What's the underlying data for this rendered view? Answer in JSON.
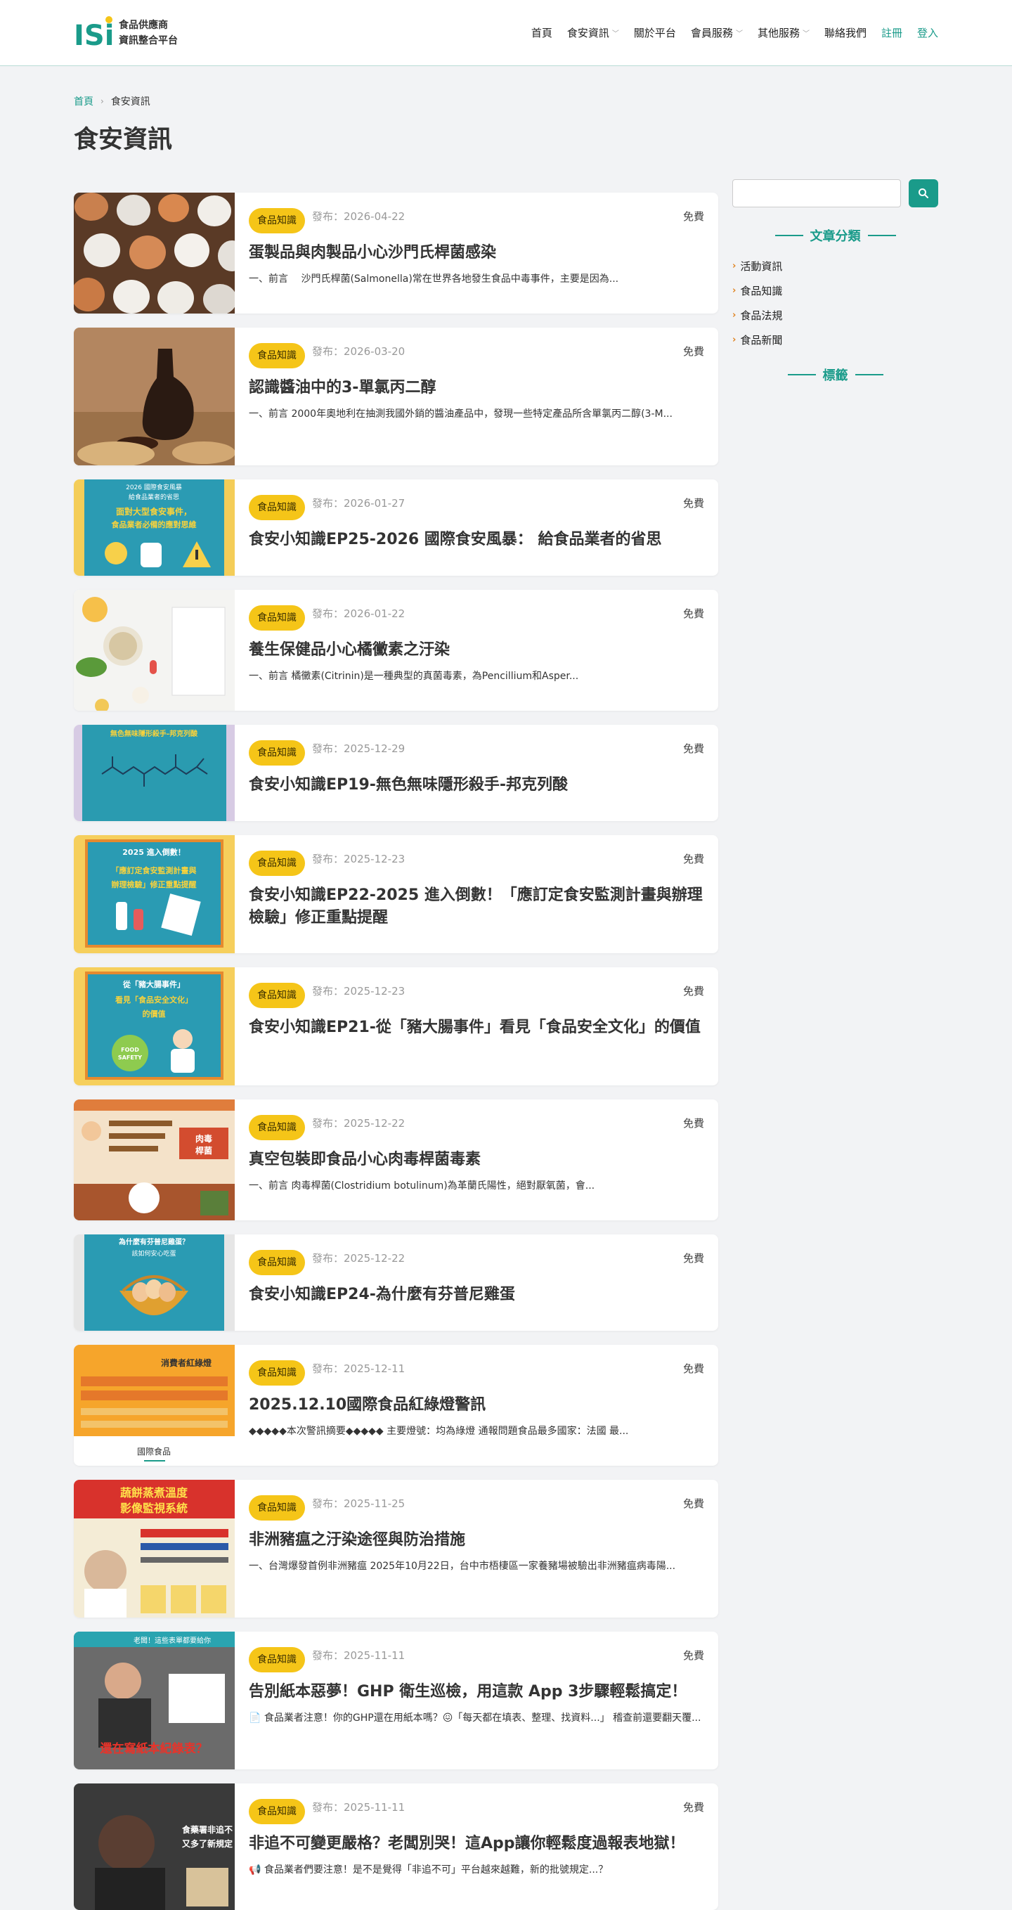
{
  "header": {
    "logo_text": "ISi",
    "brand_line1": "食品供應商",
    "brand_line2": "資訊整合平台",
    "nav": [
      {
        "label": "首頁",
        "dropdown": false
      },
      {
        "label": "食安資訊",
        "dropdown": true
      },
      {
        "label": "關於平台",
        "dropdown": false
      },
      {
        "label": "會員服務",
        "dropdown": true
      },
      {
        "label": "其他服務",
        "dropdown": true
      },
      {
        "label": "聯絡我們",
        "dropdown": false
      }
    ],
    "register_label": "註冊",
    "login_label": "登入"
  },
  "breadcrumb": {
    "home": "首頁",
    "current": "食安資訊"
  },
  "page_title": "食安資訊",
  "articles": [
    {
      "category": "食品知識",
      "date": "發布：2026-04-22",
      "price": "免費",
      "title": "蛋製品與肉製品小心沙門氏桿菌感染",
      "excerpt": "一、前言　 沙門氏桿菌(Salmonella)常在世界各地發生食品中毒事件，主要是因為..."
    },
    {
      "category": "食品知識",
      "date": "發布：2026-03-20",
      "price": "免費",
      "title": "認識醬油中的3-單氯丙二醇",
      "excerpt": "一、前言 2000年奧地利在抽測我國外銷的醬油產品中，發現一些特定產品所含單氯丙二醇(3-M..."
    },
    {
      "category": "食品知識",
      "date": "發布：2026-01-27",
      "price": "免費",
      "title": "食安小知識EP25-2026 國際食安風暴： 給食品業者的省思",
      "excerpt": ""
    },
    {
      "category": "食品知識",
      "date": "發布：2026-01-22",
      "price": "免費",
      "title": "養生保健品小心橘黴素之汙染",
      "excerpt": "一、前言 橘黴素(Citrinin)是一種典型的真菌毒素，為Pencillium和Asper..."
    },
    {
      "category": "食品知識",
      "date": "發布：2025-12-29",
      "price": "免費",
      "title": "食安小知識EP19-無色無味隱形殺手-邦克列酸",
      "excerpt": ""
    },
    {
      "category": "食品知識",
      "date": "發布：2025-12-23",
      "price": "免費",
      "title": "食安小知識EP22-2025 進入倒數！「應訂定食安監測計畫與辦理檢驗」修正重點提醒",
      "excerpt": ""
    },
    {
      "category": "食品知識",
      "date": "發布：2025-12-23",
      "price": "免費",
      "title": "食安小知識EP21-從「豬大腸事件」看見「食品安全文化」的價值",
      "excerpt": ""
    },
    {
      "category": "食品知識",
      "date": "發布：2025-12-22",
      "price": "免費",
      "title": "真空包裝即食品小心肉毒桿菌毒素",
      "excerpt": "一、前言 肉毒桿菌(Clostridium botulinum)為革蘭氏陽性，絕對厭氧菌，會..."
    },
    {
      "category": "食品知識",
      "date": "發布：2025-12-22",
      "price": "免費",
      "title": "食安小知識EP24-為什麼有芬普尼雞蛋",
      "excerpt": ""
    },
    {
      "category": "食品知識",
      "date": "發布：2025-12-11",
      "price": "免費",
      "title": "2025.12.10國際食品紅綠燈警訊",
      "excerpt": "◆◆◆◆◆本次警訊摘要◆◆◆◆◆ 主要燈號：均為綠燈 通報問題食品最多國家：法國 最..."
    },
    {
      "category": "食品知識",
      "date": "發布：2025-11-25",
      "price": "免費",
      "title": "非洲豬瘟之汙染途徑與防治措施",
      "excerpt": "一、台灣爆發首例非洲豬瘟 2025年10月22日，台中市梧棲區一家養豬場被驗出非洲豬瘟病毒陽..."
    },
    {
      "category": "食品知識",
      "date": "發布：2025-11-11",
      "price": "免費",
      "title": "告別紙本惡夢！GHP 衛生巡檢，用這款 App 3步驟輕鬆搞定！",
      "excerpt": "📄 食品業者注意！你的GHP還在用紙本嗎？😖「每天都在填表、整理、找資料...」 稽查前還要翻天覆..."
    },
    {
      "category": "食品知識",
      "date": "發布：2025-11-11",
      "price": "免費",
      "title": "非追不可變更嚴格？老闆別哭！這App讓你輕鬆度過報表地獄！",
      "excerpt": "📢 食品業者們要注意！是不是覺得「非追不可」平台越來越難，新的批號規定...？"
    }
  ],
  "thumbs": {
    "t3_line1": "2026 國際食安風暴",
    "t3_line2": "給食品業者的省思",
    "t3_line3": "面對大型食安事件，",
    "t3_line4": "食品業者必備的應對思維",
    "t5_title": "無色無味隱形殺手-邦克列酸",
    "t6_line1": "2025 進入倒數！",
    "t6_line2": "「應訂定食安監測計畫與",
    "t6_line3": "辦理檢驗」修正重點提醒",
    "t7_line1": "從「豬大腸事件」",
    "t7_line2": "看見「食品安全文化」",
    "t7_line3": "的價值",
    "t7_badge1": "FOOD",
    "t7_badge2": "SAFETY",
    "t8_tag1": "肉毒",
    "t8_tag2": "桿菌",
    "t9_line1": "為什麼有芬普尼雞蛋？",
    "t9_line2": "該如何安心吃蛋",
    "t10_title": "消費者紅綠燈",
    "t10_caption": "國際食品",
    "t11_line1": "蔬餅蒸煮溫度",
    "t11_line2": "影像監視系統",
    "t12_banner": "老闆！這些表單都要給你",
    "t12_red": "還在寫紙本紀錄表？",
    "t13_line1": "食藥署非追不",
    "t13_line2": "又多了新規定"
  },
  "sidebar": {
    "search_placeholder": "",
    "categories_heading": "文章分類",
    "categories": [
      "活動資訊",
      "食品知識",
      "食品法規",
      "食品新聞"
    ],
    "tags_heading": "標籤"
  },
  "colors": {
    "accent": "#1a9b8a",
    "badge": "#f5c518",
    "chevron": "#e0821e"
  }
}
